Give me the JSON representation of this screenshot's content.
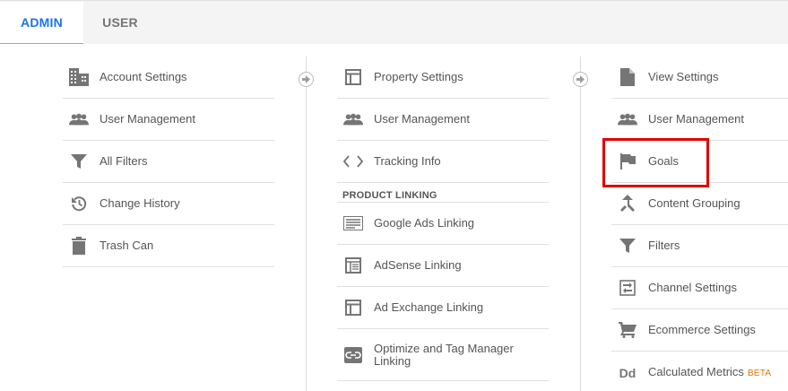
{
  "tabs": [
    {
      "label": "ADMIN",
      "active": true
    },
    {
      "label": "USER",
      "active": false
    }
  ],
  "account_column": {
    "items": [
      {
        "label": "Account Settings",
        "icon": "building-icon"
      },
      {
        "label": "User Management",
        "icon": "people-icon"
      },
      {
        "label": "All Filters",
        "icon": "filter-icon"
      },
      {
        "label": "Change History",
        "icon": "history-icon"
      },
      {
        "label": "Trash Can",
        "icon": "trash-icon"
      }
    ]
  },
  "property_column": {
    "items": [
      {
        "label": "Property Settings",
        "icon": "layout-icon"
      },
      {
        "label": "User Management",
        "icon": "people-icon"
      },
      {
        "label": "Tracking Info",
        "icon": "code-icon"
      }
    ],
    "section_label": "PRODUCT LINKING",
    "linking_items": [
      {
        "label": "Google Ads Linking",
        "icon": "ads-icon"
      },
      {
        "label": "AdSense Linking",
        "icon": "adsense-icon"
      },
      {
        "label": "Ad Exchange Linking",
        "icon": "adexchange-icon"
      },
      {
        "label": "Optimize and Tag Manager Linking",
        "icon": "link-icon"
      }
    ]
  },
  "view_column": {
    "items": [
      {
        "label": "View Settings",
        "icon": "document-icon"
      },
      {
        "label": "User Management",
        "icon": "people-icon"
      },
      {
        "label": "Goals",
        "icon": "flag-icon",
        "highlighted": true
      },
      {
        "label": "Content Grouping",
        "icon": "grouping-icon"
      },
      {
        "label": "Filters",
        "icon": "filter-icon"
      },
      {
        "label": "Channel Settings",
        "icon": "channel-icon"
      },
      {
        "label": "Ecommerce Settings",
        "icon": "cart-icon"
      },
      {
        "label": "Calculated Metrics",
        "icon": "dd-icon",
        "icon_text": "Dd",
        "badge": "BETA"
      }
    ]
  },
  "colors": {
    "active_tab": "#1a73e8",
    "tab_underline": "#f39c12",
    "highlight_box": "#e00000",
    "beta_badge": "#e37400"
  }
}
